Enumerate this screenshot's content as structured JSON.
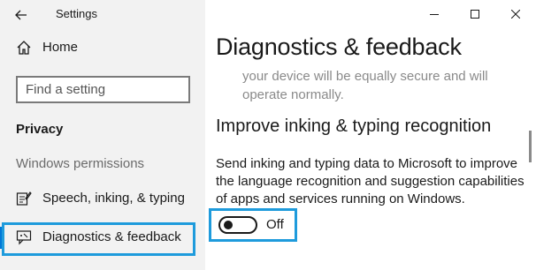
{
  "window": {
    "title": "Settings",
    "controls": [
      "minimize",
      "maximize",
      "close"
    ]
  },
  "sidebar": {
    "home_label": "Home",
    "search_placeholder": "Find a setting",
    "section_heading": "Privacy",
    "sub_heading": "Windows permissions",
    "items": [
      {
        "label": "Speech, inking, & typing",
        "icon": "speech-inking-icon",
        "selected": false
      },
      {
        "label": "Diagnostics & feedback",
        "icon": "diagnostics-feedback-icon",
        "selected": true
      }
    ]
  },
  "main": {
    "title": "Diagnostics & feedback",
    "faded_text": "your device will be equally secure and will operate normally.",
    "section_title": "Improve inking & typing recognition",
    "description": "Send inking and typing data to Microsoft to improve the language recognition and suggestion capabilities of apps and services running on Windows.",
    "toggle": {
      "state": "Off",
      "on": false
    }
  },
  "colors": {
    "accent": "#0078d7",
    "highlight": "#1e9bdc",
    "sidebar_bg": "#f2f2f2"
  }
}
